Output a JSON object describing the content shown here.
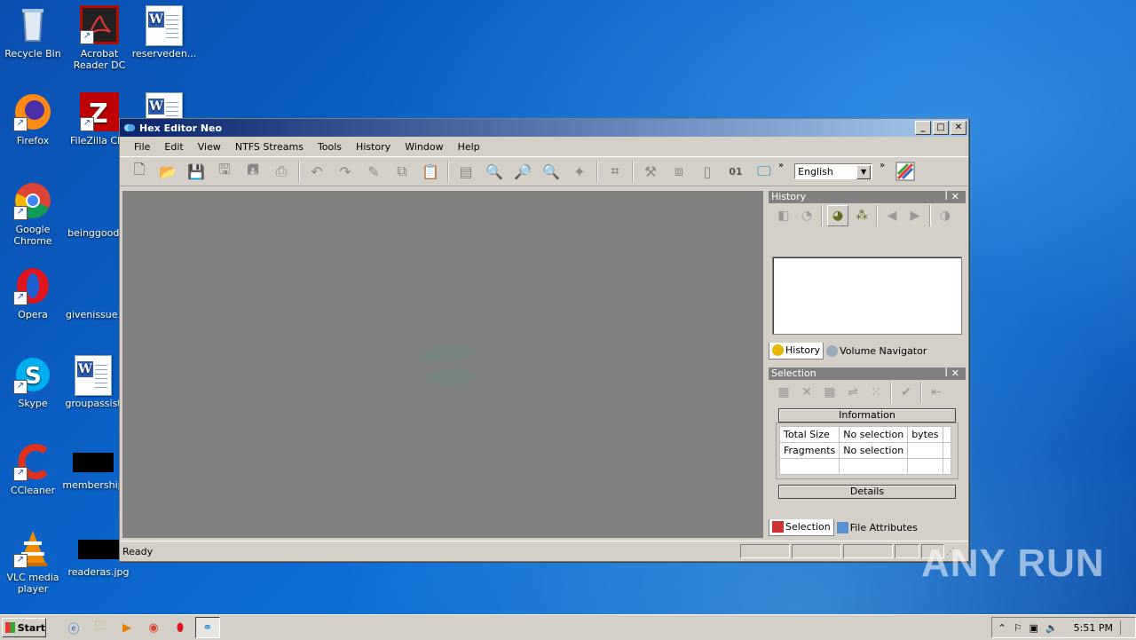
{
  "desktop": {
    "icons": [
      {
        "label": "Recycle Bin"
      },
      {
        "label": "Acrobat Reader DC"
      },
      {
        "label": "reserveden..."
      },
      {
        "label": "Firefox"
      },
      {
        "label": "FileZilla Clie"
      },
      {
        "label": "Google Chrome"
      },
      {
        "label": "beinggood."
      },
      {
        "label": "Opera"
      },
      {
        "label": "givenissue."
      },
      {
        "label": "Skype"
      },
      {
        "label": "groupassist"
      },
      {
        "label": "CCleaner"
      },
      {
        "label": "membership"
      },
      {
        "label": "VLC media player"
      },
      {
        "label": "readeras.jpg"
      }
    ]
  },
  "window": {
    "title": "Hex Editor Neo",
    "menu": [
      "File",
      "Edit",
      "View",
      "NTFS Streams",
      "Tools",
      "History",
      "Window",
      "Help"
    ],
    "language": "English",
    "status": "Ready"
  },
  "history_panel": {
    "title": "History",
    "tabs": [
      "History",
      "Volume Navigator"
    ]
  },
  "selection_panel": {
    "title": "Selection",
    "info_header": "Information",
    "rows": [
      {
        "name": "Total Size",
        "value": "No selection",
        "unit": "bytes"
      },
      {
        "name": "Fragments",
        "value": "No selection",
        "unit": ""
      }
    ],
    "details_header": "Details",
    "tabs": [
      "Selection",
      "File Attributes"
    ]
  },
  "watermark": "ANY RUN",
  "taskbar": {
    "start": "Start",
    "clock": "5:51 PM"
  }
}
